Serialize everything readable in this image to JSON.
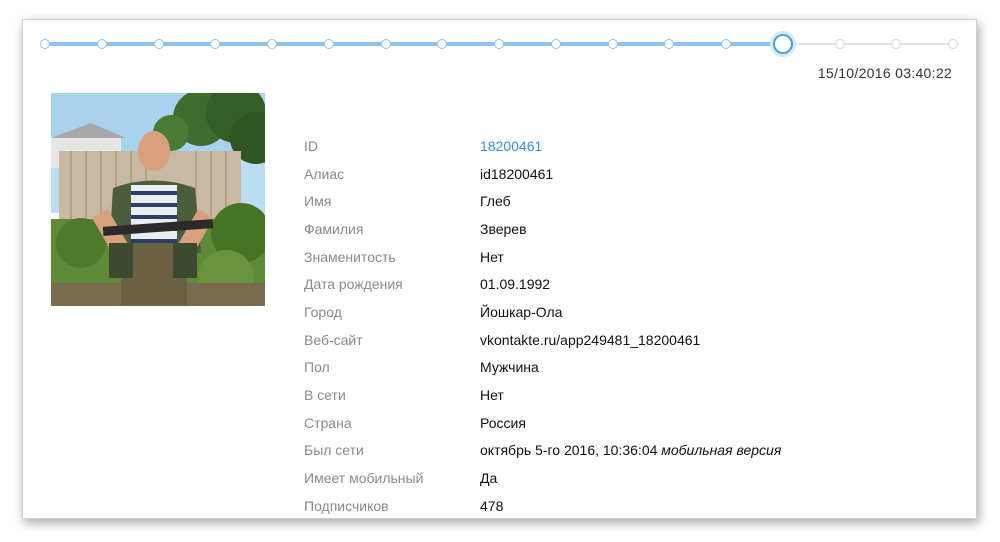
{
  "timestamp": "15/10/2016 03:40:22",
  "timeline": {
    "total_points": 17,
    "current_index": 13
  },
  "profile": [
    {
      "label": "ID",
      "value": "18200461",
      "link": true
    },
    {
      "label": "Алиас",
      "value": "id18200461"
    },
    {
      "label": "Имя",
      "value": "Глеб"
    },
    {
      "label": "Фамилия",
      "value": "Зверев"
    },
    {
      "label": "Знаменитость",
      "value": "Нет"
    },
    {
      "label": "Дата рождения",
      "value": "01.09.1992"
    },
    {
      "label": "Город",
      "value": "Йошкар-Ола"
    },
    {
      "label": "Веб-сайт",
      "value": "vkontakte.ru/app249481_18200461"
    },
    {
      "label": "Пол",
      "value": "Мужчина"
    },
    {
      "label": "В сети",
      "value": "Нет"
    },
    {
      "label": "Страна",
      "value": "Россия"
    },
    {
      "label": "Был сети",
      "value": "октябрь 5-го 2016, 10:36:04",
      "suffix": "мобильная версия"
    },
    {
      "label": "Имеет мобильный",
      "value": "Да"
    },
    {
      "label": "Подписчиков",
      "value": "478"
    }
  ],
  "colors": {
    "accent": "#3a8fd6",
    "track": "#8fc4ec",
    "label": "#8a8a8a"
  }
}
